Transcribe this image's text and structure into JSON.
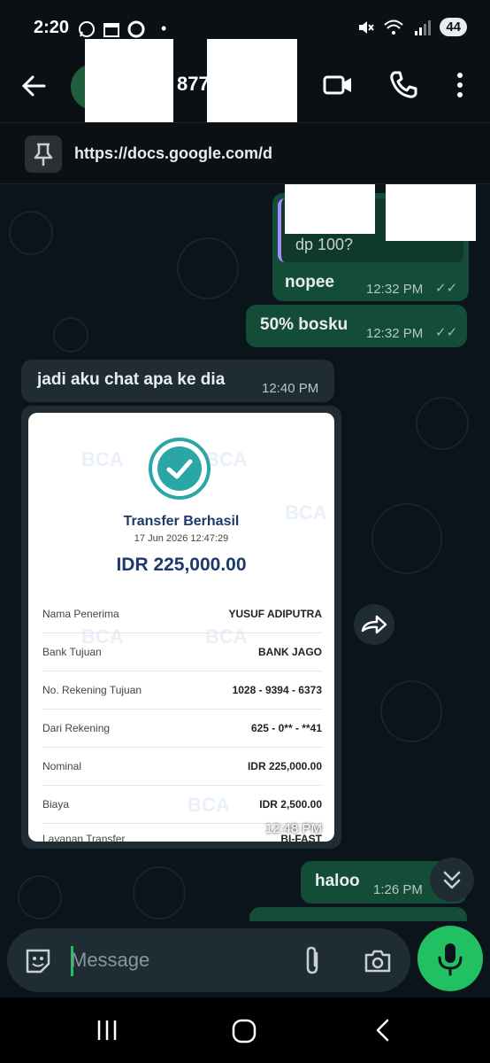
{
  "status_bar": {
    "time": "2:20",
    "battery": "44",
    "dot": "•"
  },
  "header": {
    "contact_partial": "877",
    "contact_suffix": "."
  },
  "pinned": {
    "text": "https://docs.google.com/d"
  },
  "messages": [
    {
      "text": "dp 100?"
    },
    {
      "text": "nopee",
      "time": "12:32 PM"
    },
    {
      "text": "50% bosku",
      "time": "12:32 PM"
    },
    {
      "text": "jadi aku chat apa ke dia",
      "time": "12:40 PM"
    },
    {
      "text": "haloo",
      "time": "1:26 PM"
    }
  ],
  "receipt": {
    "title": "Transfer Berhasil",
    "date": "17 Jun 2026 12:47:29",
    "amount": "IDR 225,000.00",
    "watermark": "BCA",
    "rows": [
      {
        "label": "Nama Penerima",
        "value": "YUSUF ADIPUTRA"
      },
      {
        "label": "Bank Tujuan",
        "value": "BANK JAGO"
      },
      {
        "label": "No. Rekening Tujuan",
        "value": "1028 - 9394 - 6373"
      },
      {
        "label": "Dari Rekening",
        "value": "625 - 0** - **41"
      },
      {
        "label": "Nominal",
        "value": "IDR 225,000.00"
      },
      {
        "label": "Biaya",
        "value": "IDR 2,500.00"
      },
      {
        "label": "Layanan Transfer",
        "value": "BI-FAST"
      }
    ],
    "time": "12:48 PM"
  },
  "composer": {
    "placeholder": "Message"
  },
  "colors": {
    "accent": "#21c063",
    "outgoing": "#144d37",
    "incoming": "#1f2c34",
    "background": "#0b141a"
  }
}
